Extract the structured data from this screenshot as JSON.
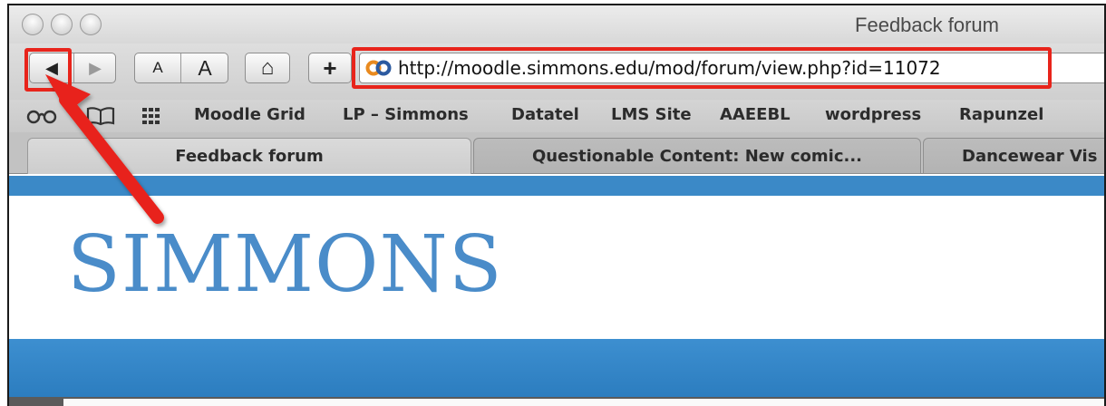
{
  "window": {
    "title": "Feedback forum"
  },
  "toolbar": {
    "back_glyph": "◀",
    "forward_glyph": "▶",
    "text_smaller_label": "A",
    "text_bigger_label": "A",
    "home_glyph": "⌂",
    "add_bookmark_label": "+",
    "url": "http://moodle.simmons.edu/mod/forum/view.php?id=11072"
  },
  "bookmarks": {
    "items": [
      "Moodle Grid",
      "LP – Simmons",
      "Datatel",
      "LMS Site",
      "AAEEBL",
      "wordpress",
      "Rapunzel"
    ]
  },
  "tabs": [
    {
      "label": "Feedback forum",
      "active": true
    },
    {
      "label": "Questionable Content: New comic...",
      "active": false
    },
    {
      "label": "Dancewear Vis",
      "active": false
    }
  ],
  "page": {
    "brand": "SIMMONS"
  },
  "colors": {
    "annotation_red": "#e8241b",
    "brand_blue": "#4a8cc9",
    "band_blue": "#3b89c7"
  }
}
